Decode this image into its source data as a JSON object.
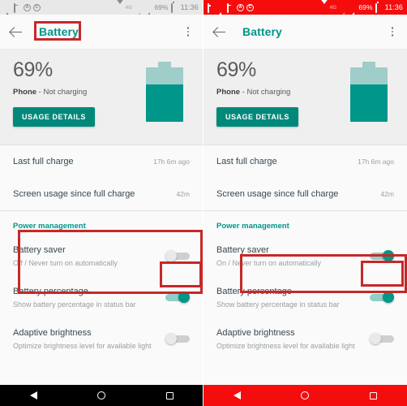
{
  "panels": [
    {
      "id": "before",
      "statusbar": {
        "mode": "normal",
        "left_icons": [
          "warning-icon",
          "cast-icon",
          "circle-a-icon",
          "circle-c-icon"
        ],
        "network_label": "4G",
        "battery_percent": "69%",
        "time": "11:36"
      },
      "appbar": {
        "title": "Battery",
        "back_label": "Back",
        "overflow_label": "More options"
      },
      "summary": {
        "percent": "69%",
        "device": "Phone",
        "state": " - Not charging",
        "button": "USAGE DETAILS"
      },
      "stats": [
        {
          "title": "Last full charge",
          "value": "17h 6m ago"
        },
        {
          "title": "Screen usage since full charge",
          "value": "42m"
        }
      ],
      "section_title": "Power management",
      "settings": [
        {
          "title": "Battery saver",
          "subtitle": "Off / Never turn on automatically",
          "toggle": "off"
        },
        {
          "title": "Battery percentage",
          "subtitle": "Show battery percentage in status bar",
          "toggle": "on"
        },
        {
          "title": "Adaptive brightness",
          "subtitle": "Optimize brightness level for available light",
          "toggle": "off"
        }
      ],
      "navbar": {
        "mode": "normal",
        "back": "Back",
        "home": "Home",
        "recents": "Recents"
      }
    },
    {
      "id": "after",
      "statusbar": {
        "mode": "saver",
        "left_icons": [
          "image-icon",
          "warning-icon",
          "cast-icon",
          "circle-a-icon",
          "circle-c-icon"
        ],
        "network_label": "4G",
        "battery_percent": "69%",
        "time": "11:36"
      },
      "appbar": {
        "title": "Battery",
        "back_label": "Back",
        "overflow_label": "More options"
      },
      "summary": {
        "percent": "69%",
        "device": "Phone",
        "state": " - Not charging",
        "button": "USAGE DETAILS"
      },
      "stats": [
        {
          "title": "Last full charge",
          "value": "17h 6m ago"
        },
        {
          "title": "Screen usage since full charge",
          "value": "42m"
        }
      ],
      "section_title": "Power management",
      "settings": [
        {
          "title": "Battery saver",
          "subtitle": "On / Never turn on automatically",
          "toggle": "on"
        },
        {
          "title": "Battery percentage",
          "subtitle": "Show battery percentage in status bar",
          "toggle": "on"
        },
        {
          "title": "Adaptive brightness",
          "subtitle": "Optimize brightness level for available light",
          "toggle": "off"
        }
      ],
      "navbar": {
        "mode": "saver",
        "back": "Back",
        "home": "Home",
        "recents": "Recents"
      }
    }
  ],
  "colors": {
    "accent_teal": "#009688",
    "button_teal": "#00897b",
    "highlight_red": "#c62828",
    "saver_red": "#f50d0d",
    "battery_fill": "#00968a",
    "battery_shell": "#9fcdc9"
  }
}
